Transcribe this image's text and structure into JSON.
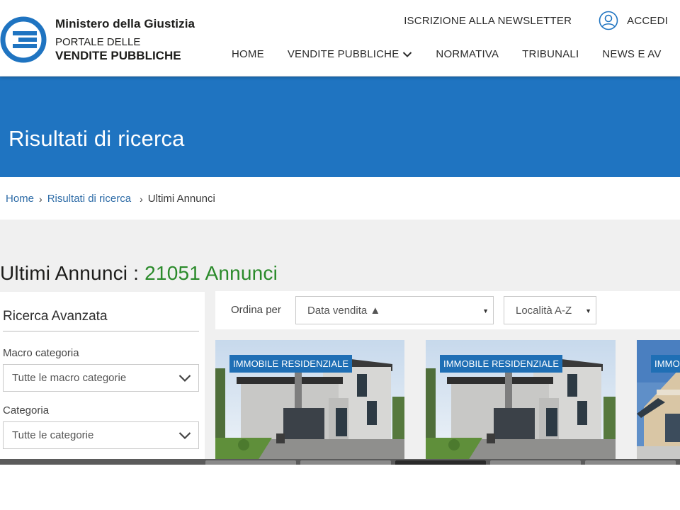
{
  "header": {
    "brand_line1": "Ministero della Giustizia",
    "brand_line2": "PORTALE DELLE",
    "brand_line3": "VENDITE PUBBLICHE",
    "newsletter": "ISCRIZIONE ALLA NEWSLETTER",
    "login": "ACCEDI",
    "nav": [
      "HOME",
      "VENDITE PUBBLICHE",
      "NORMATIVA",
      "TRIBUNALI",
      "NEWS E AV"
    ]
  },
  "banner": {
    "title": "Risultati di ricerca"
  },
  "breadcrumb": {
    "home": "Home",
    "results": "Risultati di ricerca",
    "current": "Ultimi Annunci"
  },
  "results": {
    "title_prefix": "Ultimi Annunci : ",
    "count_text": "21051 Annunci"
  },
  "sidebar": {
    "title": "Ricerca Avanzata",
    "macro_label": "Macro categoria",
    "macro_value": "Tutte le macro categorie",
    "category_label": "Categoria",
    "category_value": "Tutte le categorie"
  },
  "sort": {
    "label": "Ordina per",
    "date_value": "Data vendita ▲",
    "locality_value": "Località A-Z"
  },
  "cards": [
    {
      "badge": "IMMOBILE RESIDENZIALE"
    },
    {
      "badge": "IMMOBILE RESIDENZIALE"
    },
    {
      "badge": "IMMO"
    }
  ],
  "colors": {
    "brand_blue": "#1f74c1",
    "badge_blue": "#1f6fb5",
    "count_green": "#2a8a2a",
    "link_blue": "#2e6ca7"
  },
  "icons": [
    "portal-logo-icon",
    "user-circle-icon",
    "chevron-down-icon",
    "breadcrumb-chevron-icon",
    "dropdown-caret-icon"
  ]
}
